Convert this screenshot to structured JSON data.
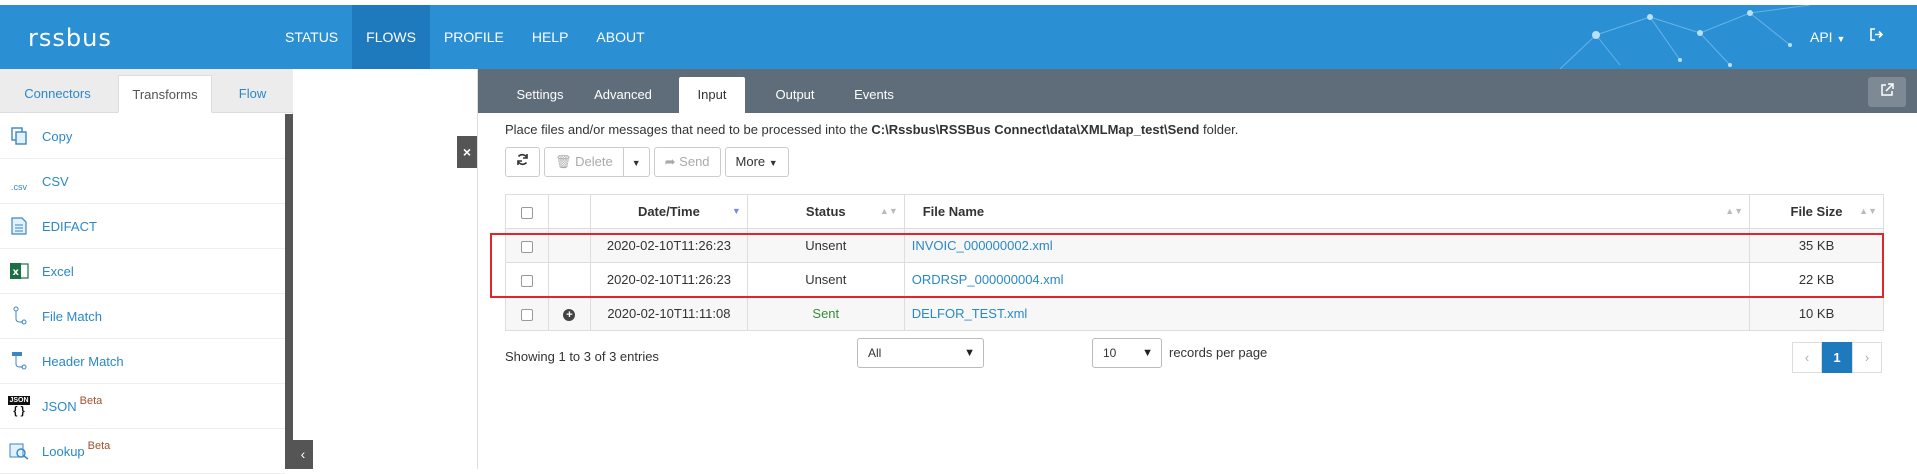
{
  "app": {
    "logo": "rssbus"
  },
  "nav": {
    "items": [
      {
        "label": "STATUS"
      },
      {
        "label": "FLOWS"
      },
      {
        "label": "PROFILE"
      },
      {
        "label": "HELP"
      },
      {
        "label": "ABOUT"
      }
    ],
    "api_label": "API",
    "logout_icon": "sign-out-icon"
  },
  "left_panel": {
    "tabs": [
      {
        "label": "Connectors"
      },
      {
        "label": "Transforms"
      },
      {
        "label": "Flow"
      }
    ],
    "items": [
      {
        "label": "Copy",
        "icon": "copy-icon"
      },
      {
        "label": "CSV",
        "icon": "csv-icon",
        "icon_text": ".csv"
      },
      {
        "label": "EDIFACT",
        "icon": "edifact-icon"
      },
      {
        "label": "Excel",
        "icon": "excel-icon"
      },
      {
        "label": "File Match",
        "icon": "file-match-icon"
      },
      {
        "label": "Header Match",
        "icon": "header-match-icon"
      },
      {
        "label": "JSON",
        "icon": "json-icon",
        "badge": "Beta",
        "icon_text": "JSON",
        "icon_text2": "{ }"
      },
      {
        "label": "Lookup",
        "icon": "lookup-icon",
        "badge": "Beta"
      }
    ]
  },
  "right_panel": {
    "tabs": [
      {
        "label": "Settings"
      },
      {
        "label": "Advanced"
      },
      {
        "label": "Input"
      },
      {
        "label": "Output"
      },
      {
        "label": "Events"
      }
    ],
    "active_tab": "Input",
    "info_prefix": "Place files and/or messages that need to be processed into the",
    "info_path": "C:\\Rssbus\\RSSBus Connect\\data\\XMLMap_test\\Send",
    "info_suffix": "folder.",
    "toolbar": {
      "delete_label": "Delete",
      "send_label": "Send",
      "more_label": "More"
    },
    "table": {
      "columns": [
        "Date/Time",
        "Status",
        "File Name",
        "File Size"
      ],
      "rows": [
        {
          "datetime": "2020-02-10T11:26:23",
          "status": "Unsent",
          "filename": "INVOIC_000000002.xml",
          "size": "35 KB"
        },
        {
          "datetime": "2020-02-10T11:26:23",
          "status": "Unsent",
          "filename": "ORDRSP_000000004.xml",
          "size": "22 KB"
        },
        {
          "datetime": "2020-02-10T11:11:08",
          "status": "Sent",
          "filename": "DELFOR_TEST.xml",
          "size": "10 KB"
        }
      ]
    },
    "footer": {
      "showing": "Showing 1 to 3 of 3 entries",
      "filter_value": "All",
      "page_size": "10",
      "page_size_suffix": "records per page",
      "current_page": "1"
    }
  },
  "colors": {
    "topbar": "#2b8fd4",
    "nav_active": "#1e79bd",
    "tab_bar": "#5f6d7a",
    "link": "#2a88c8",
    "highlight": "#e0262b",
    "sent_status": "#3a8a3a"
  }
}
